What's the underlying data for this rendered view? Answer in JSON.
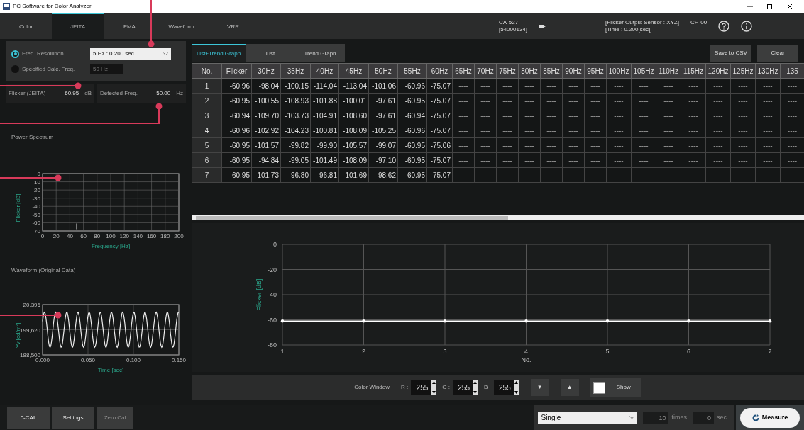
{
  "window": {
    "title": "PC Software for Color Analyzer"
  },
  "tabs": [
    {
      "label": "Color",
      "selected": false
    },
    {
      "label": "JEITA",
      "selected": true
    },
    {
      "label": "FMA",
      "selected": false
    },
    {
      "label": "Waveform",
      "selected": false
    },
    {
      "label": "VRR",
      "selected": false
    }
  ],
  "device": {
    "model": "CA-527",
    "serial": "[54000134]",
    "sensor_lines": [
      "[Flicker Output Sensor : XYZ]",
      "[Time : 0.200[sec]]"
    ],
    "channel": "CH-00"
  },
  "settings": {
    "options": [
      {
        "kind": "dropdown",
        "label": "Freq. Resolution",
        "selected": true,
        "value": "5 Hz : 0.200 sec"
      },
      {
        "kind": "field",
        "label": "Specified Calc. Freq.",
        "selected": false,
        "placeholder": "50 Hz"
      }
    ]
  },
  "readings": [
    {
      "label": "Flicker (JEITA)",
      "value": "-60.95",
      "unit": "dB"
    },
    {
      "label": "Detected Freq.",
      "value": "50.00",
      "unit": "Hz"
    }
  ],
  "power_spectrum": {
    "title": "Power Spectrum",
    "xlabel": "Frequency [Hz]",
    "ylabel": "Flicker [dB]",
    "xticks": [
      "0",
      "20",
      "40",
      "60",
      "80",
      "100",
      "120",
      "140",
      "160",
      "180",
      "200"
    ],
    "yticks": [
      "0",
      "-10",
      "-20",
      "-30",
      "-40",
      "-50",
      "-60",
      "-70"
    ]
  },
  "waveform": {
    "title": "Waveform (Original Data)",
    "xlabel": "Time [sec]",
    "ylabel": "Yv [cd/m²]",
    "xticks": [
      "0.000",
      "0.050",
      "0.100",
      "0.150"
    ],
    "yticks": [
      "20,396",
      "199,620",
      "188,500"
    ]
  },
  "view_tabs": [
    {
      "label": "List+Trend Graph",
      "selected": true
    },
    {
      "label": "List",
      "selected": false
    },
    {
      "label": "Trend Graph",
      "selected": false
    }
  ],
  "actions": [
    "Save to CSV",
    "Clear"
  ],
  "table": {
    "columns": [
      "No.",
      "Flicker",
      "30Hz",
      "35Hz",
      "40Hz",
      "45Hz",
      "50Hz",
      "55Hz",
      "60Hz",
      "65Hz",
      "70Hz",
      "75Hz",
      "80Hz",
      "85Hz",
      "90Hz",
      "95Hz",
      "100Hz",
      "105Hz",
      "110Hz",
      "115Hz",
      "120Hz",
      "125Hz",
      "130Hz",
      "135"
    ],
    "rows": [
      [
        "1",
        "-60.96",
        "-98.04",
        "-100.15",
        "-114.04",
        "-113.04",
        "-101.06",
        "-60.96",
        "-75.07",
        "----",
        "----",
        "----",
        "----",
        "----",
        "----",
        "----",
        "----",
        "----",
        "----",
        "----",
        "----",
        "----",
        "----",
        "----"
      ],
      [
        "2",
        "-60.95",
        "-100.55",
        "-108.93",
        "-101.88",
        "-100.01",
        "-97.61",
        "-60.95",
        "-75.07",
        "----",
        "----",
        "----",
        "----",
        "----",
        "----",
        "----",
        "----",
        "----",
        "----",
        "----",
        "----",
        "----",
        "----",
        "----"
      ],
      [
        "3",
        "-60.94",
        "-109.70",
        "-103.73",
        "-104.91",
        "-108.60",
        "-97.61",
        "-60.94",
        "-75.07",
        "----",
        "----",
        "----",
        "----",
        "----",
        "----",
        "----",
        "----",
        "----",
        "----",
        "----",
        "----",
        "----",
        "----",
        "----"
      ],
      [
        "4",
        "-60.96",
        "-102.92",
        "-104.23",
        "-100.81",
        "-108.09",
        "-105.25",
        "-60.96",
        "-75.07",
        "----",
        "----",
        "----",
        "----",
        "----",
        "----",
        "----",
        "----",
        "----",
        "----",
        "----",
        "----",
        "----",
        "----",
        "----"
      ],
      [
        "5",
        "-60.95",
        "-101.57",
        "-99.82",
        "-99.90",
        "-105.57",
        "-99.07",
        "-60.95",
        "-75.06",
        "----",
        "----",
        "----",
        "----",
        "----",
        "----",
        "----",
        "----",
        "----",
        "----",
        "----",
        "----",
        "----",
        "----",
        "----"
      ],
      [
        "6",
        "-60.95",
        "-94.84",
        "-99.05",
        "-101.49",
        "-108.09",
        "-97.10",
        "-60.95",
        "-75.07",
        "----",
        "----",
        "----",
        "----",
        "----",
        "----",
        "----",
        "----",
        "----",
        "----",
        "----",
        "----",
        "----",
        "----",
        "----"
      ],
      [
        "7",
        "-60.95",
        "-101.73",
        "-96.80",
        "-96.81",
        "-101.69",
        "-98.62",
        "-60.95",
        "-75.07",
        "----",
        "----",
        "----",
        "----",
        "----",
        "----",
        "----",
        "----",
        "----",
        "----",
        "----",
        "----",
        "----",
        "----",
        "----"
      ]
    ]
  },
  "trend": {
    "chart_data": {
      "type": "line",
      "xlabel": "No.",
      "ylabel": "Flicker [dB]",
      "x": [
        1,
        2,
        3,
        4,
        5,
        6,
        7
      ],
      "grid": true,
      "series": [
        {
          "color": "#ffffff",
          "values": [
            -61,
            -61,
            -61,
            -61,
            -61,
            -61,
            -61
          ]
        }
      ],
      "xlim": [
        1,
        7
      ],
      "ylim": [
        -80,
        0
      ],
      "xticks": [
        1,
        2,
        3,
        4,
        5,
        6,
        7
      ],
      "yticks": [
        0,
        -20,
        -40,
        -60,
        -80
      ]
    }
  },
  "color_window": {
    "label": "Color Window",
    "channels": [
      {
        "label": "R :",
        "value": "255"
      },
      {
        "label": "G :",
        "value": "255"
      },
      {
        "label": "B :",
        "value": "255"
      }
    ],
    "steps": [
      "▼",
      "▲"
    ],
    "show": "Show"
  },
  "bottom": {
    "buttons": [
      {
        "label": "0-CAL",
        "disabled": false
      },
      {
        "label": "Settings",
        "disabled": false
      },
      {
        "label": "Zero Cal",
        "disabled": true
      }
    ],
    "mode": "Single",
    "count": {
      "placeholder": "10",
      "unit": "times",
      "disabled": true
    },
    "interval": {
      "placeholder": "0",
      "unit": "sec",
      "disabled": true
    },
    "measure": "Measure"
  }
}
